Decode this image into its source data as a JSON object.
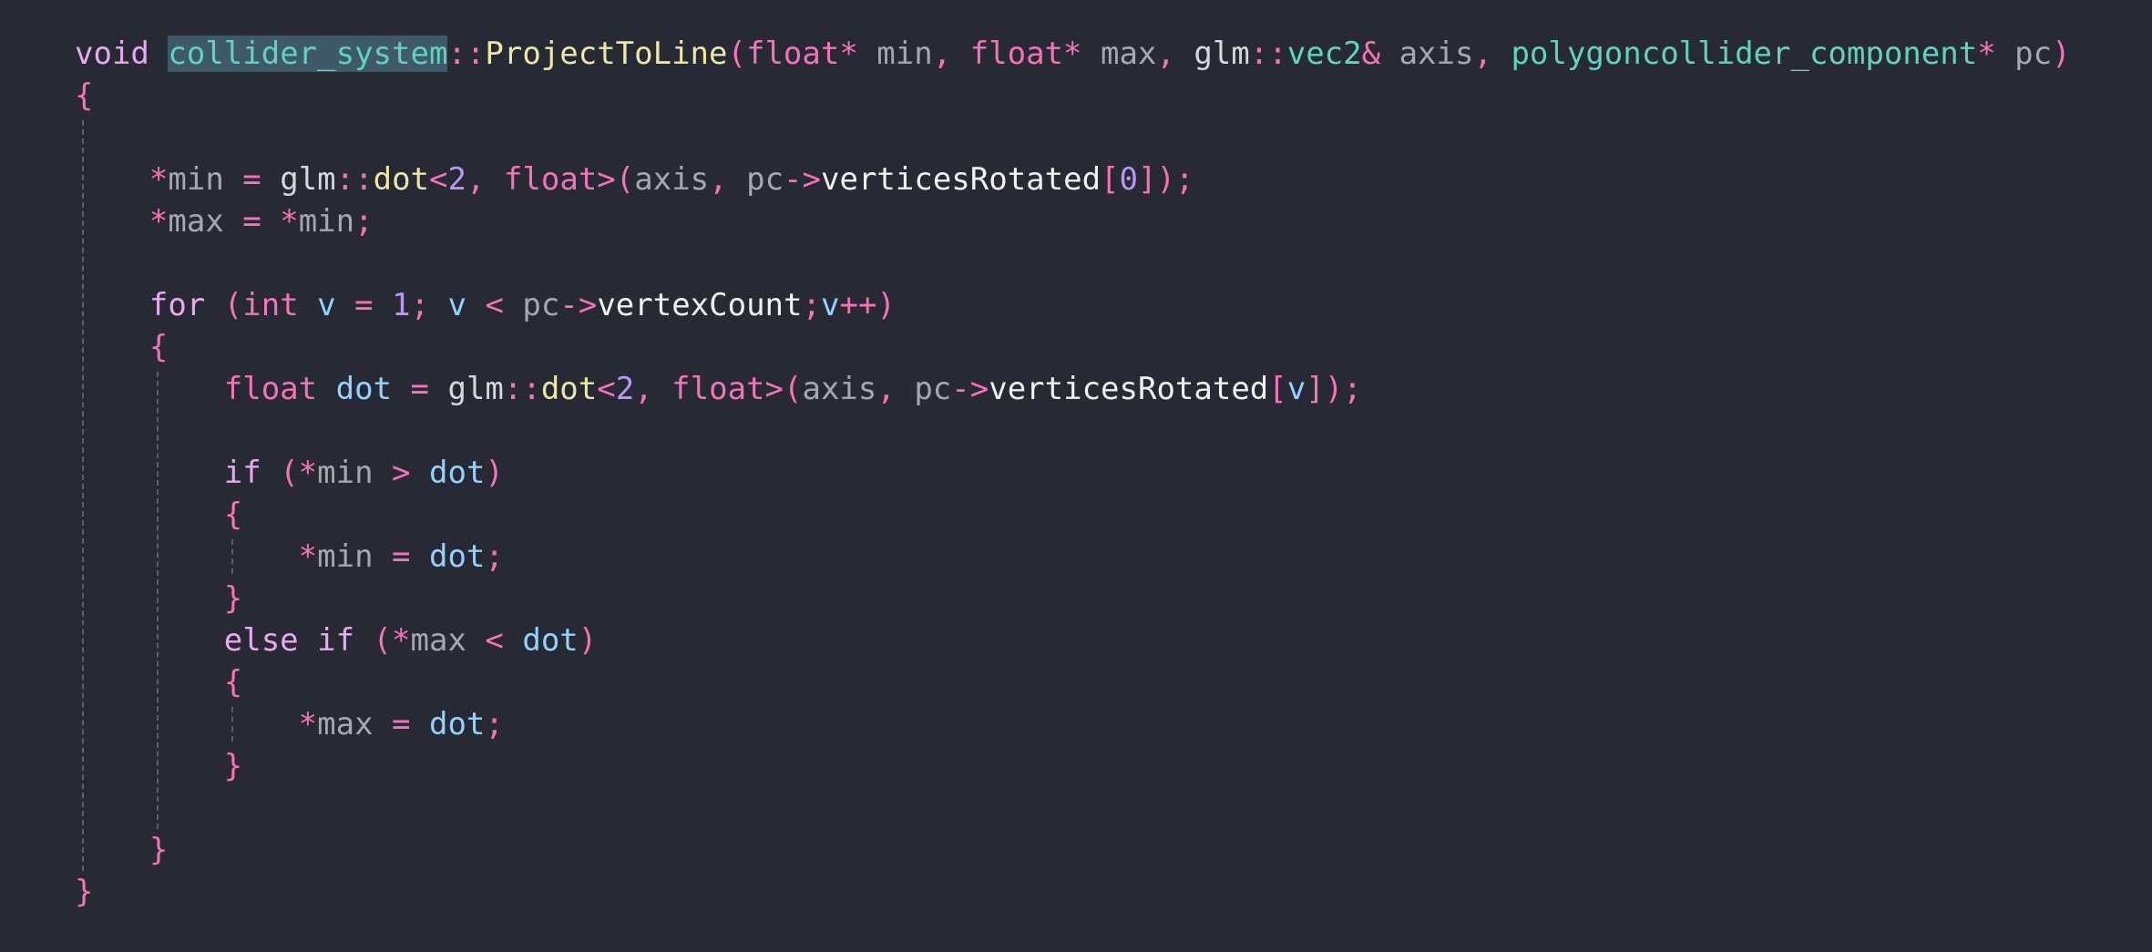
{
  "editor": {
    "theme_colors": {
      "background": "#272935",
      "keyword": "#f571b8",
      "type": "#5fd2c0",
      "function": "#ece7a4",
      "parameter": "#a6a8b0",
      "variable": "#8fd4ff",
      "number": "#b996f7",
      "member": "#f2f2f2",
      "selection": "#3e5a66"
    },
    "lines": [
      [
        {
          "t": "void",
          "c": "kw2"
        },
        {
          "t": " ",
          "c": "plain"
        },
        {
          "t": "collider_system",
          "c": "type",
          "hl": true
        },
        {
          "t": "::",
          "c": "punct"
        },
        {
          "t": "ProjectToLine",
          "c": "fn"
        },
        {
          "t": "(",
          "c": "punct"
        },
        {
          "t": "float",
          "c": "kw"
        },
        {
          "t": "*",
          "c": "punct"
        },
        {
          "t": " min",
          "c": "param"
        },
        {
          "t": ",",
          "c": "punct"
        },
        {
          "t": " ",
          "c": "plain"
        },
        {
          "t": "float",
          "c": "kw"
        },
        {
          "t": "*",
          "c": "punct"
        },
        {
          "t": " max",
          "c": "param"
        },
        {
          "t": ",",
          "c": "punct"
        },
        {
          "t": " glm",
          "c": "ns"
        },
        {
          "t": "::",
          "c": "punct"
        },
        {
          "t": "vec2",
          "c": "type"
        },
        {
          "t": "&",
          "c": "punct"
        },
        {
          "t": " axis",
          "c": "param"
        },
        {
          "t": ",",
          "c": "punct"
        },
        {
          "t": " ",
          "c": "plain"
        },
        {
          "t": "polygoncollider_component",
          "c": "type"
        },
        {
          "t": "*",
          "c": "punct"
        },
        {
          "t": " pc",
          "c": "param"
        },
        {
          "t": ")",
          "c": "punct"
        }
      ],
      [
        {
          "t": "{",
          "c": "punct"
        }
      ],
      [],
      [
        {
          "t": "    ",
          "c": "plain"
        },
        {
          "t": "*",
          "c": "punct"
        },
        {
          "t": "min",
          "c": "param"
        },
        {
          "t": " = ",
          "c": "punct"
        },
        {
          "t": "glm",
          "c": "ns"
        },
        {
          "t": "::",
          "c": "punct"
        },
        {
          "t": "dot",
          "c": "fn"
        },
        {
          "t": "<",
          "c": "punct"
        },
        {
          "t": "2",
          "c": "num"
        },
        {
          "t": ", ",
          "c": "punct"
        },
        {
          "t": "float",
          "c": "kw"
        },
        {
          "t": ">(",
          "c": "punct"
        },
        {
          "t": "axis",
          "c": "param"
        },
        {
          "t": ", ",
          "c": "punct"
        },
        {
          "t": "pc",
          "c": "param"
        },
        {
          "t": "->",
          "c": "punct"
        },
        {
          "t": "verticesRotated",
          "c": "member"
        },
        {
          "t": "[",
          "c": "punct"
        },
        {
          "t": "0",
          "c": "num"
        },
        {
          "t": "]);",
          "c": "punct"
        }
      ],
      [
        {
          "t": "    ",
          "c": "plain"
        },
        {
          "t": "*",
          "c": "punct"
        },
        {
          "t": "max",
          "c": "param"
        },
        {
          "t": " = ",
          "c": "punct"
        },
        {
          "t": "*",
          "c": "punct"
        },
        {
          "t": "min",
          "c": "param"
        },
        {
          "t": ";",
          "c": "punct"
        }
      ],
      [],
      [
        {
          "t": "    ",
          "c": "plain"
        },
        {
          "t": "for",
          "c": "kw2"
        },
        {
          "t": " (",
          "c": "punct"
        },
        {
          "t": "int",
          "c": "kw"
        },
        {
          "t": " ",
          "c": "plain"
        },
        {
          "t": "v",
          "c": "var"
        },
        {
          "t": " = ",
          "c": "punct"
        },
        {
          "t": "1",
          "c": "num"
        },
        {
          "t": "; ",
          "c": "punct"
        },
        {
          "t": "v",
          "c": "var"
        },
        {
          "t": " < ",
          "c": "punct"
        },
        {
          "t": "pc",
          "c": "param"
        },
        {
          "t": "->",
          "c": "punct"
        },
        {
          "t": "vertexCount",
          "c": "member"
        },
        {
          "t": ";",
          "c": "punct"
        },
        {
          "t": "v",
          "c": "var"
        },
        {
          "t": "++)",
          "c": "punct"
        }
      ],
      [
        {
          "t": "    ",
          "c": "plain"
        },
        {
          "t": "{",
          "c": "punct"
        }
      ],
      [
        {
          "t": "        ",
          "c": "plain"
        },
        {
          "t": "float",
          "c": "kw"
        },
        {
          "t": " ",
          "c": "plain"
        },
        {
          "t": "dot",
          "c": "var"
        },
        {
          "t": " = ",
          "c": "punct"
        },
        {
          "t": "glm",
          "c": "ns"
        },
        {
          "t": "::",
          "c": "punct"
        },
        {
          "t": "dot",
          "c": "fn"
        },
        {
          "t": "<",
          "c": "punct"
        },
        {
          "t": "2",
          "c": "num"
        },
        {
          "t": ", ",
          "c": "punct"
        },
        {
          "t": "float",
          "c": "kw"
        },
        {
          "t": ">(",
          "c": "punct"
        },
        {
          "t": "axis",
          "c": "param"
        },
        {
          "t": ", ",
          "c": "punct"
        },
        {
          "t": "pc",
          "c": "param"
        },
        {
          "t": "->",
          "c": "punct"
        },
        {
          "t": "verticesRotated",
          "c": "member"
        },
        {
          "t": "[",
          "c": "punct"
        },
        {
          "t": "v",
          "c": "var"
        },
        {
          "t": "]);",
          "c": "punct"
        }
      ],
      [],
      [
        {
          "t": "        ",
          "c": "plain"
        },
        {
          "t": "if",
          "c": "kw2"
        },
        {
          "t": " (",
          "c": "punct"
        },
        {
          "t": "*",
          "c": "punct"
        },
        {
          "t": "min",
          "c": "param"
        },
        {
          "t": " > ",
          "c": "punct"
        },
        {
          "t": "dot",
          "c": "var"
        },
        {
          "t": ")",
          "c": "punct"
        }
      ],
      [
        {
          "t": "        ",
          "c": "plain"
        },
        {
          "t": "{",
          "c": "punct"
        }
      ],
      [
        {
          "t": "            ",
          "c": "plain"
        },
        {
          "t": "*",
          "c": "punct"
        },
        {
          "t": "min",
          "c": "param"
        },
        {
          "t": " = ",
          "c": "punct"
        },
        {
          "t": "dot",
          "c": "var"
        },
        {
          "t": ";",
          "c": "punct"
        }
      ],
      [
        {
          "t": "        ",
          "c": "plain"
        },
        {
          "t": "}",
          "c": "punct"
        }
      ],
      [
        {
          "t": "        ",
          "c": "plain"
        },
        {
          "t": "else if",
          "c": "kw2"
        },
        {
          "t": " (",
          "c": "punct"
        },
        {
          "t": "*",
          "c": "punct"
        },
        {
          "t": "max",
          "c": "param"
        },
        {
          "t": " < ",
          "c": "punct"
        },
        {
          "t": "dot",
          "c": "var"
        },
        {
          "t": ")",
          "c": "punct"
        }
      ],
      [
        {
          "t": "        ",
          "c": "plain"
        },
        {
          "t": "{",
          "c": "punct"
        }
      ],
      [
        {
          "t": "            ",
          "c": "plain"
        },
        {
          "t": "*",
          "c": "punct"
        },
        {
          "t": "max",
          "c": "param"
        },
        {
          "t": " = ",
          "c": "punct"
        },
        {
          "t": "dot",
          "c": "var"
        },
        {
          "t": ";",
          "c": "punct"
        }
      ],
      [
        {
          "t": "        ",
          "c": "plain"
        },
        {
          "t": "}",
          "c": "punct"
        }
      ],
      [],
      [
        {
          "t": "    ",
          "c": "plain"
        },
        {
          "t": "}",
          "c": "punct"
        }
      ],
      [
        {
          "t": "}",
          "c": "punct"
        }
      ]
    ]
  }
}
